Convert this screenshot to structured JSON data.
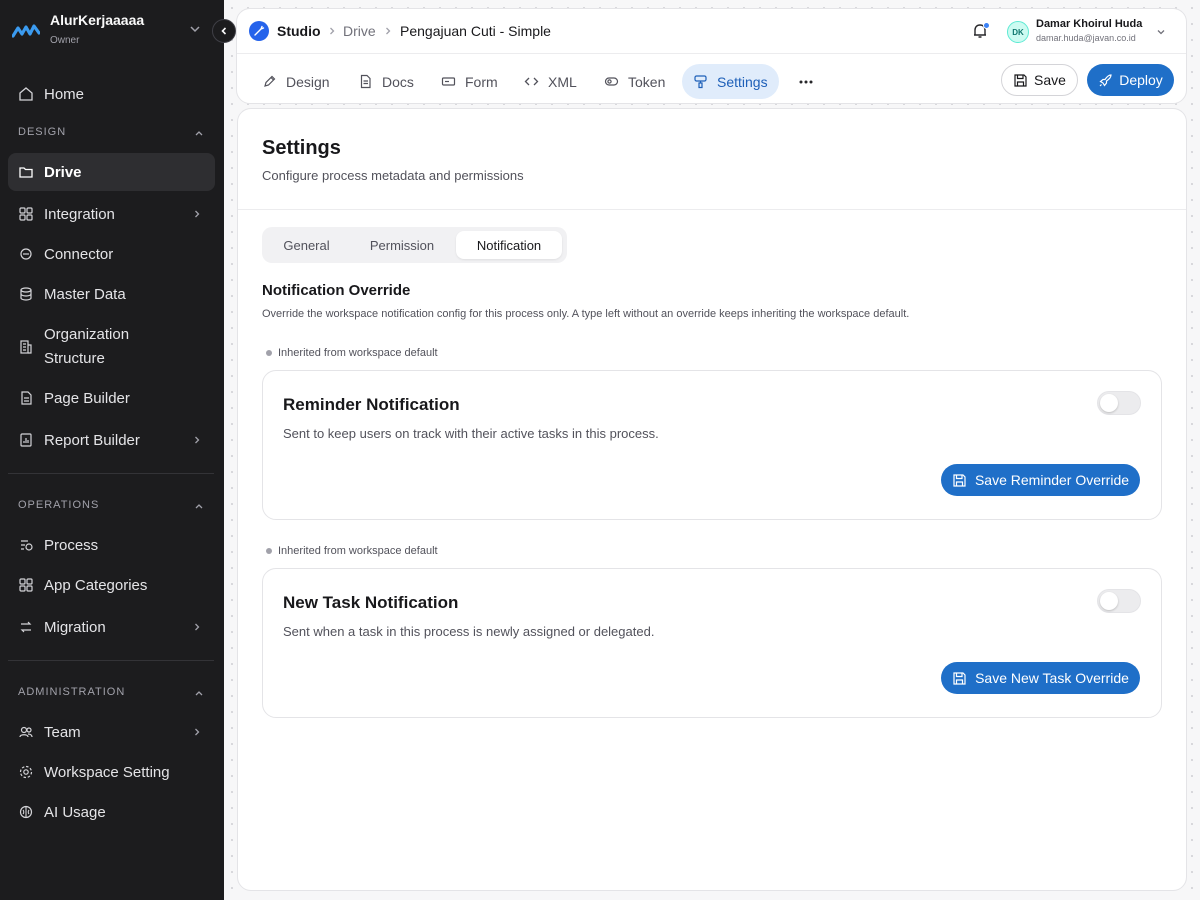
{
  "workspace": {
    "name": "AlurKerjaaaaa",
    "role": "Owner"
  },
  "sidebar": {
    "home": "Home",
    "design_section": "DESIGN",
    "design_items": [
      {
        "label": "Drive",
        "icon": "folder-icon",
        "active": true
      },
      {
        "label": "Integration",
        "icon": "grid-icon",
        "has_arrow": true
      },
      {
        "label": "Connector",
        "icon": "plug-icon"
      },
      {
        "label": "Master Data",
        "icon": "database-icon"
      },
      {
        "label": "Organization Structure",
        "icon": "building-icon"
      },
      {
        "label": "Page Builder",
        "icon": "page-icon"
      },
      {
        "label": "Report Builder",
        "icon": "report-icon",
        "has_arrow": true
      }
    ],
    "operations_section": "OPERATIONS",
    "operations_items": [
      {
        "label": "Process",
        "icon": "process-icon"
      },
      {
        "label": "App Categories",
        "icon": "grid-icon"
      },
      {
        "label": "Migration",
        "icon": "migration-icon",
        "has_arrow": true
      }
    ],
    "admin_section": "ADMINISTRATION",
    "admin_items": [
      {
        "label": "Team",
        "icon": "team-icon",
        "has_arrow": true
      },
      {
        "label": "Workspace Setting",
        "icon": "gear-icon"
      },
      {
        "label": "AI Usage",
        "icon": "ai-icon"
      }
    ]
  },
  "breadcrumb": {
    "studio": "Studio",
    "drive": "Drive",
    "page": "Pengajuan Cuti - Simple"
  },
  "user": {
    "initials": "DK",
    "name": "Damar Khoirul Huda",
    "email": "damar.huda@javan.co.id"
  },
  "tabs": [
    {
      "label": "Design",
      "icon": "pen-icon"
    },
    {
      "label": "Docs",
      "icon": "doc-icon"
    },
    {
      "label": "Form",
      "icon": "form-icon"
    },
    {
      "label": "XML",
      "icon": "code-icon"
    },
    {
      "label": "Token",
      "icon": "token-icon"
    },
    {
      "label": "Settings",
      "icon": "brush-icon",
      "active": true
    }
  ],
  "actions": {
    "save": "Save",
    "deploy": "Deploy"
  },
  "settings": {
    "title": "Settings",
    "subtitle": "Configure process metadata and permissions",
    "segments": [
      "General",
      "Permission",
      "Notification"
    ],
    "active_segment": "Notification",
    "section_title": "Notification Override",
    "section_desc": "Override the workspace notification config for this process only. A type left without an override keeps inheriting the workspace default.",
    "cards": [
      {
        "status": "Inherited from workspace default",
        "title": "Reminder Notification",
        "desc": "Sent to keep users on track with their active tasks in this process.",
        "enabled": false,
        "button": "Save Reminder Override"
      },
      {
        "status": "Inherited from workspace default",
        "title": "New Task Notification",
        "desc": "Sent when a task in this process is newly assigned or delegated.",
        "enabled": false,
        "button": "Save New Task Override"
      }
    ]
  },
  "colors": {
    "accent": "#1f6fc8",
    "sidebar_bg": "#1c1c1e",
    "active_tab_bg": "#e0ecfb"
  }
}
